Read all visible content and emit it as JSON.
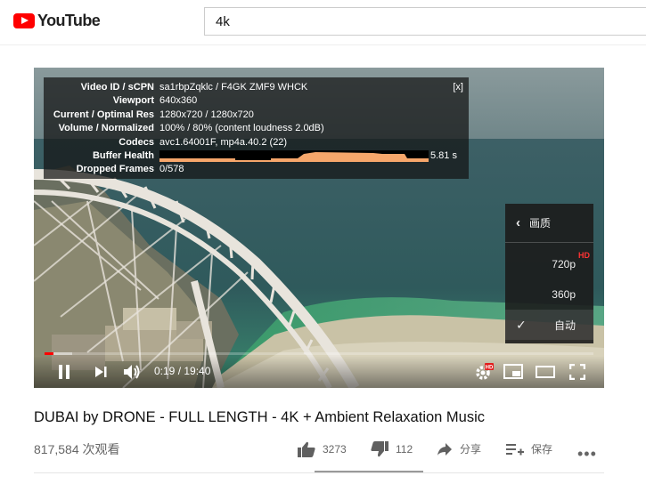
{
  "header": {
    "logo_text": "YouTube",
    "search_value": "4k"
  },
  "stats": {
    "close_label": "[x]",
    "rows": [
      {
        "label": "Video ID / sCPN",
        "value": "sa1rbpZqklc / F4GK ZMF9 WHCK"
      },
      {
        "label": "Viewport",
        "value": "640x360"
      },
      {
        "label": "Current / Optimal Res",
        "value": "1280x720 / 1280x720"
      },
      {
        "label": "Volume / Normalized",
        "value": "100% / 80% (content loudness 2.0dB)"
      },
      {
        "label": "Codecs",
        "value": "avc1.64001F, mp4a.40.2 (22)"
      },
      {
        "label": "Buffer Health",
        "value": "5.81 s"
      },
      {
        "label": "Dropped Frames",
        "value": "0/578"
      }
    ]
  },
  "quality_menu": {
    "title": "画质",
    "back_icon": "chevron-left",
    "options": [
      {
        "label": "720p",
        "badge": "HD"
      },
      {
        "label": "360p",
        "badge": ""
      },
      {
        "label": "自动",
        "badge": "",
        "selected": true
      }
    ]
  },
  "controls": {
    "time": "0:19 / 19:40",
    "progress_fraction": 0.016,
    "buffer_fraction": 0.05,
    "settings_badge": "HD"
  },
  "video": {
    "title": "DUBAI by DRONE - FULL LENGTH - 4K + Ambient Relaxation Music",
    "views": "817,584 次观看",
    "likes": "3273",
    "dislikes": "112",
    "share_label": "分享",
    "save_label": "保存",
    "more_label": "•••"
  },
  "colors": {
    "brand_red": "#ff0000",
    "buffer_orange": "#f6a66b"
  }
}
